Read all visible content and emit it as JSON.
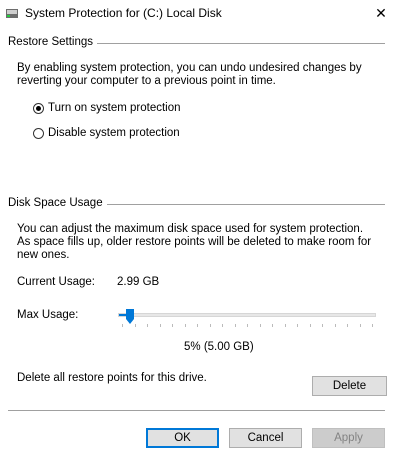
{
  "window": {
    "title": "System Protection for  (C:) Local Disk",
    "close_glyph": "✕"
  },
  "restore_settings": {
    "group_title": "Restore Settings",
    "description": "By enabling system protection, you can undo undesired changes by reverting your computer to a previous point in time.",
    "options": [
      {
        "label": "Turn on system protection",
        "selected": true
      },
      {
        "label": "Disable system protection",
        "selected": false
      }
    ]
  },
  "disk_space": {
    "group_title": "Disk Space Usage",
    "description": "You can adjust the maximum disk space used for system protection. As space fills up, older restore points will be deleted to make room for new ones.",
    "current_usage_label": "Current Usage:",
    "current_usage_value": "2.99 GB",
    "max_usage_label": "Max Usage:",
    "max_usage_percent": 5,
    "max_usage_value": "5% (5.00 GB)",
    "delete_text": "Delete all restore points for this drive.",
    "delete_button": "Delete"
  },
  "footer": {
    "ok": "OK",
    "cancel": "Cancel",
    "apply": "Apply"
  },
  "colors": {
    "accent": "#0078d7",
    "disabled_text": "#838383"
  }
}
